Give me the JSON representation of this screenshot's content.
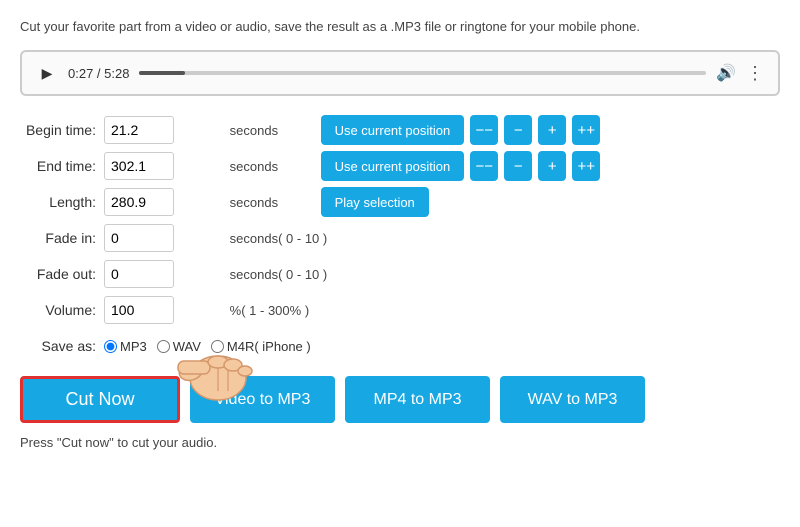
{
  "description": "Cut your favorite part from a video or audio, save the result as a .MP3 file or ringtone for your mobile phone.",
  "player": {
    "current_time": "0:27",
    "total_time": "5:28",
    "progress_percent": 8
  },
  "form": {
    "begin_time_label": "Begin time:",
    "begin_time_value": "21.2",
    "begin_time_unit": "seconds",
    "end_time_label": "End time:",
    "end_time_value": "302.1",
    "end_time_unit": "seconds",
    "length_label": "Length:",
    "length_value": "280.9",
    "length_unit": "seconds",
    "fade_in_label": "Fade in:",
    "fade_in_value": "0",
    "fade_in_unit": "seconds( 0 - 10 )",
    "fade_out_label": "Fade out:",
    "fade_out_value": "0",
    "fade_out_unit": "seconds( 0 - 10 )",
    "volume_label": "Volume:",
    "volume_value": "100",
    "volume_unit": "%( 1 - 300% )",
    "save_as_label": "Save as:",
    "save_as_options": [
      "MP3",
      "WAV",
      "M4R( iPhone )"
    ],
    "save_as_selected": "MP3"
  },
  "buttons": {
    "use_current_position": "Use current position",
    "play_selection": "Play selection",
    "cut_now": "Cut Now",
    "video_to_mp3": "Video to MP3",
    "mp4_to_mp3": "MP4 to MP3",
    "wav_to_mp3": "WAV to MP3",
    "minus_minus": "−−",
    "minus": "−",
    "plus": "+",
    "plus_plus": "++"
  },
  "status": "Press \"Cut now\" to cut your audio."
}
